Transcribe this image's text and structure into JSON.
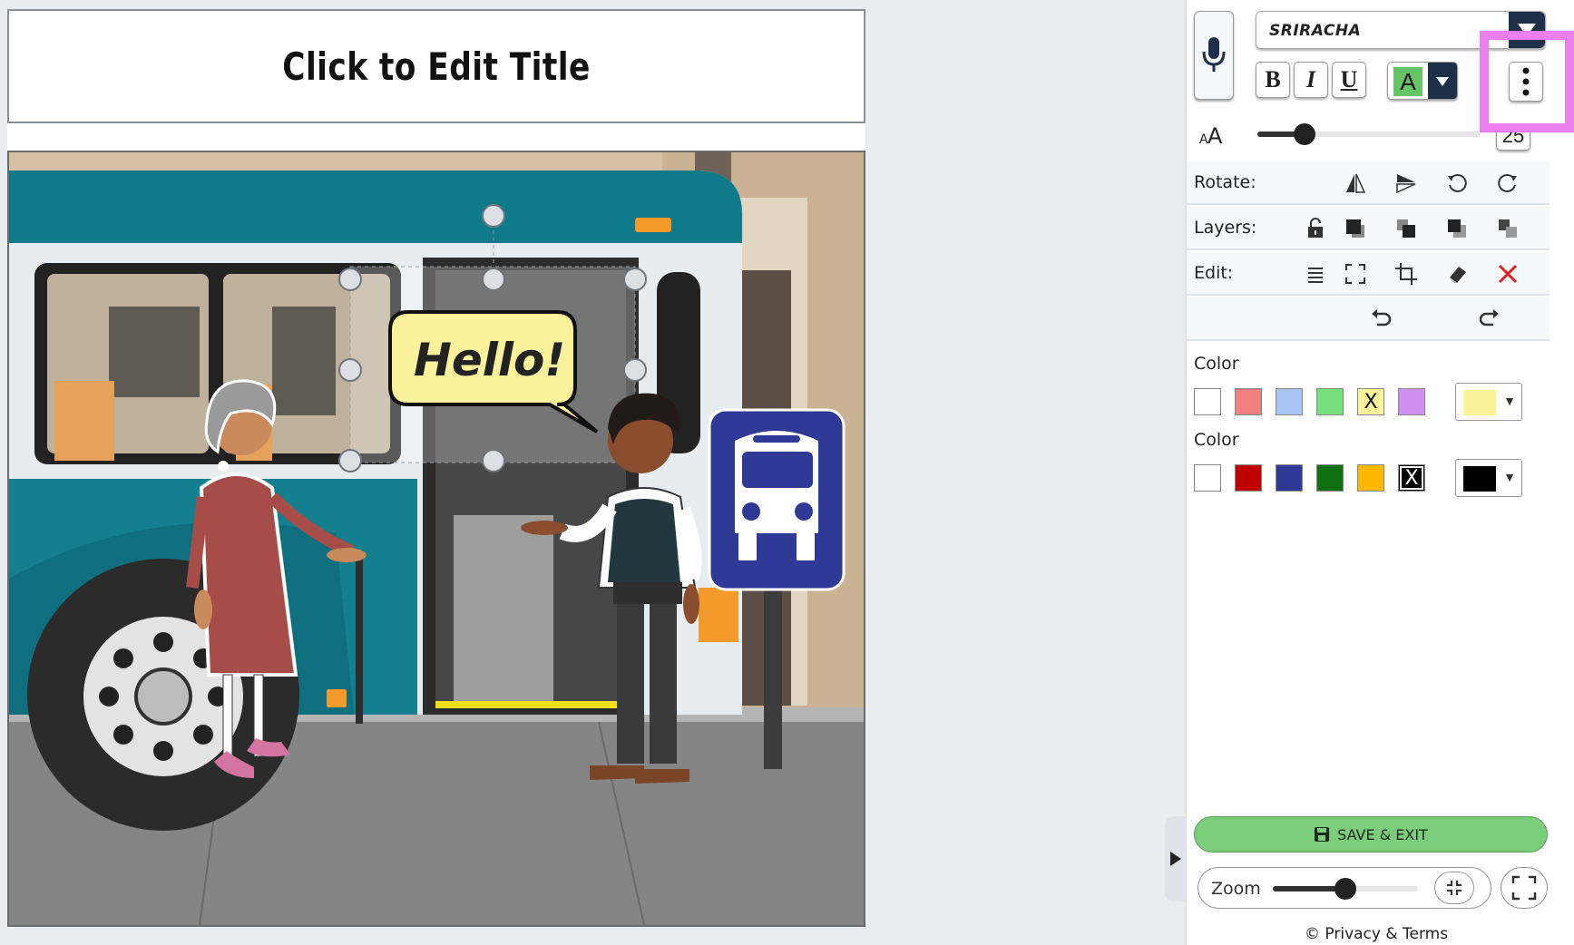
{
  "title": {
    "text": "Click to Edit Title"
  },
  "scene": {
    "speech_bubble_text": "Hello!"
  },
  "panel": {
    "font_name": "SRIRACHA",
    "bold_label": "B",
    "italic_label": "I",
    "underline_label": "U",
    "text_color_label": "A",
    "font_size_value": "25",
    "font_size_fraction": 0.21,
    "rows": {
      "rotate": "Rotate:",
      "layers": "Layers:",
      "edit": "Edit:"
    },
    "fill_color": {
      "label": "Color",
      "swatches": [
        "#ffffff",
        "#f08080",
        "#a8c4f5",
        "#77e07a",
        "#fbf29b",
        "#cf8ef2"
      ],
      "selected_index": 4,
      "selected_mark": "X",
      "current": "#fbf29b"
    },
    "outline_color": {
      "label": "Color",
      "swatches": [
        "#ffffff",
        "#c00000",
        "#2e3a96",
        "#107010",
        "#ffb800",
        "#000000"
      ],
      "selected_index": 5,
      "selected_mark": "X",
      "current": "#000000"
    },
    "save_label": "SAVE & EXIT",
    "zoom_label": "Zoom",
    "zoom_fraction": 0.5,
    "privacy_text": "© Privacy & Terms"
  },
  "colors": {
    "accent_dark": "#1e2f4a",
    "save_green": "#7bcc7b",
    "highlight_pink": "#ee7ff0"
  }
}
